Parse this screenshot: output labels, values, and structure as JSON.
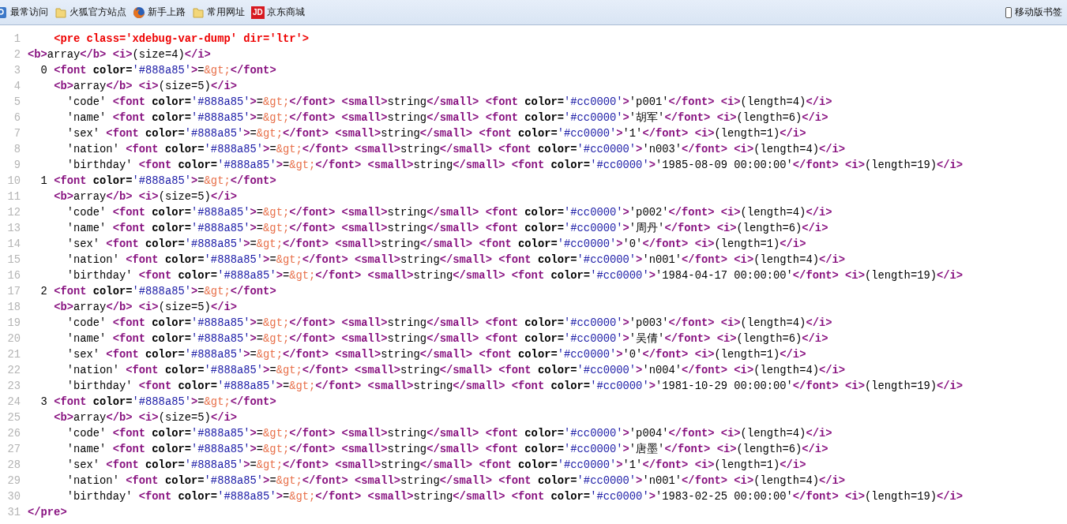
{
  "bookmarks_bar": {
    "items": [
      {
        "kind": "special",
        "label": "最常访问"
      },
      {
        "kind": "folder",
        "label": "火狐官方站点"
      },
      {
        "kind": "firefox",
        "label": "新手上路"
      },
      {
        "kind": "folder",
        "label": "常用网址"
      },
      {
        "kind": "jd",
        "label": "京东商城",
        "badge": "JD"
      }
    ],
    "mobile": {
      "label": "移动版书签"
    }
  },
  "source": {
    "lines": [
      {
        "number": "1",
        "kind": "error",
        "text": "    <pre class='xdebug-var-dump' dir='ltr'>"
      },
      {
        "number": "2",
        "kind": "source",
        "text": "<b>array</b> <i>(size=4)</i>"
      },
      {
        "number": "3",
        "kind": "source",
        "text": "  0 <font color='#888a85'>=&gt;</font>"
      },
      {
        "number": "4",
        "kind": "source",
        "text": "    <b>array</b> <i>(size=5)</i>"
      },
      {
        "number": "5",
        "kind": "source",
        "text": "      'code' <font color='#888a85'>=&gt;</font> <small>string</small> <font color='#cc0000'>'p001'</font> <i>(length=4)</i>"
      },
      {
        "number": "6",
        "kind": "source",
        "text": "      'name' <font color='#888a85'>=&gt;</font> <small>string</small> <font color='#cc0000'>'胡军'</font> <i>(length=6)</i>"
      },
      {
        "number": "7",
        "kind": "source",
        "text": "      'sex' <font color='#888a85'>=&gt;</font> <small>string</small> <font color='#cc0000'>'1'</font> <i>(length=1)</i>"
      },
      {
        "number": "8",
        "kind": "source",
        "text": "      'nation' <font color='#888a85'>=&gt;</font> <small>string</small> <font color='#cc0000'>'n003'</font> <i>(length=4)</i>"
      },
      {
        "number": "9",
        "kind": "source",
        "text": "      'birthday' <font color='#888a85'>=&gt;</font> <small>string</small> <font color='#cc0000'>'1985-08-09 00:00:00'</font> <i>(length=19)</i>"
      },
      {
        "number": "10",
        "kind": "source",
        "text": "  1 <font color='#888a85'>=&gt;</font>"
      },
      {
        "number": "11",
        "kind": "source",
        "text": "    <b>array</b> <i>(size=5)</i>"
      },
      {
        "number": "12",
        "kind": "source",
        "text": "      'code' <font color='#888a85'>=&gt;</font> <small>string</small> <font color='#cc0000'>'p002'</font> <i>(length=4)</i>"
      },
      {
        "number": "13",
        "kind": "source",
        "text": "      'name' <font color='#888a85'>=&gt;</font> <small>string</small> <font color='#cc0000'>'周丹'</font> <i>(length=6)</i>"
      },
      {
        "number": "14",
        "kind": "source",
        "text": "      'sex' <font color='#888a85'>=&gt;</font> <small>string</small> <font color='#cc0000'>'0'</font> <i>(length=1)</i>"
      },
      {
        "number": "15",
        "kind": "source",
        "text": "      'nation' <font color='#888a85'>=&gt;</font> <small>string</small> <font color='#cc0000'>'n001'</font> <i>(length=4)</i>"
      },
      {
        "number": "16",
        "kind": "source",
        "text": "      'birthday' <font color='#888a85'>=&gt;</font> <small>string</small> <font color='#cc0000'>'1984-04-17 00:00:00'</font> <i>(length=19)</i>"
      },
      {
        "number": "17",
        "kind": "source",
        "text": "  2 <font color='#888a85'>=&gt;</font>"
      },
      {
        "number": "18",
        "kind": "source",
        "text": "    <b>array</b> <i>(size=5)</i>"
      },
      {
        "number": "19",
        "kind": "source",
        "text": "      'code' <font color='#888a85'>=&gt;</font> <small>string</small> <font color='#cc0000'>'p003'</font> <i>(length=4)</i>"
      },
      {
        "number": "20",
        "kind": "source",
        "text": "      'name' <font color='#888a85'>=&gt;</font> <small>string</small> <font color='#cc0000'>'吴倩'</font> <i>(length=6)</i>"
      },
      {
        "number": "21",
        "kind": "source",
        "text": "      'sex' <font color='#888a85'>=&gt;</font> <small>string</small> <font color='#cc0000'>'0'</font> <i>(length=1)</i>"
      },
      {
        "number": "22",
        "kind": "source",
        "text": "      'nation' <font color='#888a85'>=&gt;</font> <small>string</small> <font color='#cc0000'>'n004'</font> <i>(length=4)</i>"
      },
      {
        "number": "23",
        "kind": "source",
        "text": "      'birthday' <font color='#888a85'>=&gt;</font> <small>string</small> <font color='#cc0000'>'1981-10-29 00:00:00'</font> <i>(length=19)</i>"
      },
      {
        "number": "24",
        "kind": "source",
        "text": "  3 <font color='#888a85'>=&gt;</font>"
      },
      {
        "number": "25",
        "kind": "source",
        "text": "    <b>array</b> <i>(size=5)</i>"
      },
      {
        "number": "26",
        "kind": "source",
        "text": "      'code' <font color='#888a85'>=&gt;</font> <small>string</small> <font color='#cc0000'>'p004'</font> <i>(length=4)</i>"
      },
      {
        "number": "27",
        "kind": "source",
        "text": "      'name' <font color='#888a85'>=&gt;</font> <small>string</small> <font color='#cc0000'>'唐墨'</font> <i>(length=6)</i>"
      },
      {
        "number": "28",
        "kind": "source",
        "text": "      'sex' <font color='#888a85'>=&gt;</font> <small>string</small> <font color='#cc0000'>'1'</font> <i>(length=1)</i>"
      },
      {
        "number": "29",
        "kind": "source",
        "text": "      'nation' <font color='#888a85'>=&gt;</font> <small>string</small> <font color='#cc0000'>'n001'</font> <i>(length=4)</i>"
      },
      {
        "number": "30",
        "kind": "source",
        "text": "      'birthday' <font color='#888a85'>=&gt;</font> <small>string</small> <font color='#cc0000'>'1983-02-25 00:00:00'</font> <i>(length=19)</i>"
      },
      {
        "number": "31",
        "kind": "source",
        "text": "</pre>"
      }
    ]
  }
}
